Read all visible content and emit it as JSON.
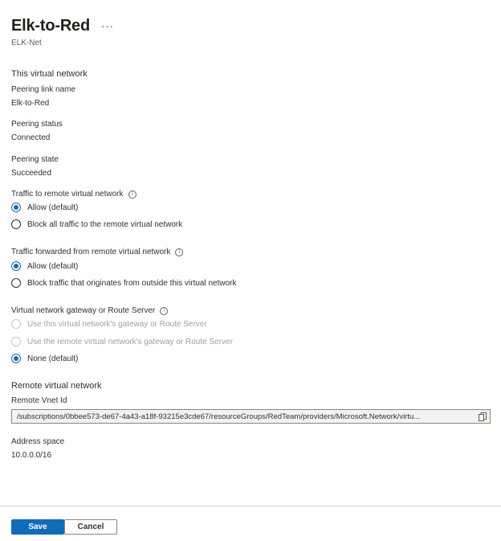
{
  "header": {
    "title": "Elk-to-Red",
    "more_label": "···",
    "subtitle": "ELK-Net"
  },
  "this_vnet": {
    "heading": "This virtual network",
    "peering_link_name_label": "Peering link name",
    "peering_link_name_value": "Elk-to-Red",
    "peering_status_label": "Peering status",
    "peering_status_value": "Connected",
    "peering_state_label": "Peering state",
    "peering_state_value": "Succeeded"
  },
  "traffic_to_remote": {
    "label": "Traffic to remote virtual network",
    "options": [
      {
        "label": "Allow (default)",
        "checked": true,
        "disabled": false
      },
      {
        "label": "Block all traffic to the remote virtual network",
        "checked": false,
        "disabled": false
      }
    ]
  },
  "traffic_forwarded": {
    "label": "Traffic forwarded from remote virtual network",
    "options": [
      {
        "label": "Allow (default)",
        "checked": true,
        "disabled": false
      },
      {
        "label": "Block traffic that originates from outside this virtual network",
        "checked": false,
        "disabled": false
      }
    ]
  },
  "gateway": {
    "label": "Virtual network gateway or Route Server",
    "options": [
      {
        "label": "Use this virtual network's gateway or Route Server",
        "checked": false,
        "disabled": true
      },
      {
        "label": "Use the remote virtual network's gateway or Route Server",
        "checked": false,
        "disabled": true
      },
      {
        "label": "None (default)",
        "checked": true,
        "disabled": false
      }
    ]
  },
  "remote_vnet": {
    "heading": "Remote virtual network",
    "vnet_id_label": "Remote Vnet Id",
    "vnet_id_value": "/subscriptions/0bbee573-de67-4a43-a18f-93215e3cde67/resourceGroups/RedTeam/providers/Microsoft.Network/virtu...",
    "address_space_label": "Address space",
    "address_space_value": "10.0.0.0/16"
  },
  "footer": {
    "save_label": "Save",
    "cancel_label": "Cancel"
  },
  "colors": {
    "accent": "#0f6cbd",
    "text": "#323130",
    "disabled_text": "#a19f9d",
    "field_background": "#f3f2f1"
  },
  "icons": {
    "more": "more-horizontal-icon",
    "info": "info-icon",
    "copy": "copy-icon"
  }
}
